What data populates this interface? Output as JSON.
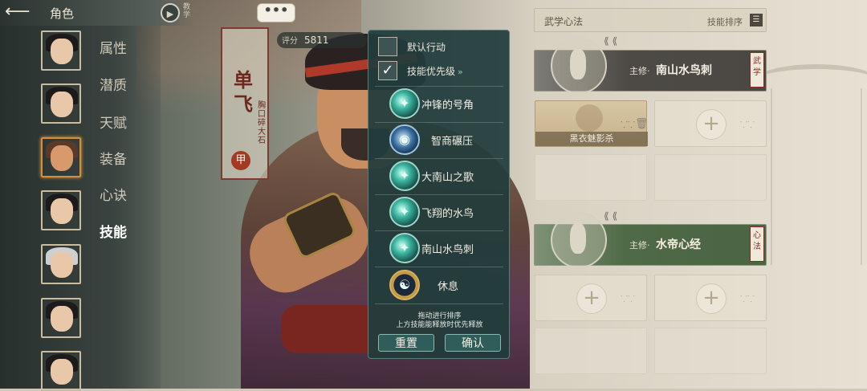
{
  "header": {
    "back_icon": "arrow-left-icon",
    "title": "角色",
    "tutorial_label": "教学"
  },
  "sidebar": {
    "menu": [
      {
        "label": "属性"
      },
      {
        "label": "潜质"
      },
      {
        "label": "天赋"
      },
      {
        "label": "装备"
      },
      {
        "label": "心诀"
      },
      {
        "label": "技能",
        "active": true
      }
    ],
    "selected_avatar_index": 2
  },
  "character": {
    "name_chars": [
      "单",
      "飞"
    ],
    "nickname": "胸口碎大石",
    "grade": "甲",
    "score_label": "评分",
    "score_value": "5811",
    "speech_bubble": "•••"
  },
  "skill_panel": {
    "default_action": {
      "label": "默认行动",
      "checked": false
    },
    "skill_priority": {
      "label": "技能优先级",
      "checked": true,
      "chevron": "»"
    },
    "skills": [
      {
        "name": "冲锋的号角",
        "icon": "teal-swirl-icon"
      },
      {
        "name": "智商碾压",
        "icon": "blue-orb-icon"
      },
      {
        "name": "大南山之歌",
        "icon": "teal-swirl-icon"
      },
      {
        "name": "飞翔的水鸟",
        "icon": "teal-swirl-icon"
      },
      {
        "name": "南山水鸟刺",
        "icon": "teal-swirl-icon"
      },
      {
        "name": "休息",
        "icon": "meditation-icon"
      }
    ],
    "hint_line1": "拖动进行排序",
    "hint_line2": "上方技能能释放时优先释放",
    "reset_label": "重置",
    "confirm_label": "确认"
  },
  "martial_arts": {
    "title": "武学心法",
    "sort_label": "技能排序",
    "primary": {
      "main_label": "主修·",
      "name": "南山水鸟刺",
      "tag": "武学"
    },
    "equipped_technique": "黑衣魅影杀",
    "secondary": {
      "main_label": "主修·",
      "name": "水帝心经",
      "tag": "心法"
    }
  },
  "colors": {
    "panel_bg": "#213c3c",
    "accent_red": "#a33a22",
    "selected_avatar": "#d68e3a"
  }
}
